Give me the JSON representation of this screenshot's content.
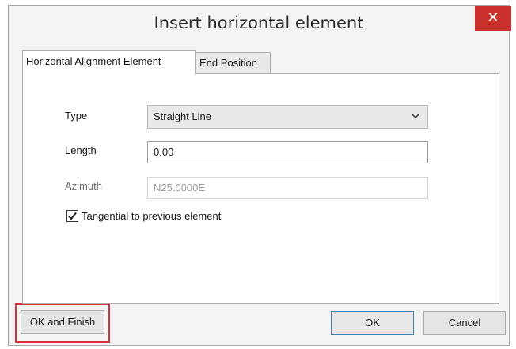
{
  "dialog": {
    "title": "Insert horizontal element",
    "close_glyph": "✕"
  },
  "tabs": [
    {
      "label": "Horizontal Alignment Element",
      "active": true
    },
    {
      "label": "End Position",
      "active": false
    }
  ],
  "form": {
    "type_label": "Type",
    "type_value": "Straight Line",
    "length_label": "Length",
    "length_value": "0.00",
    "azimuth_label": "Azimuth",
    "azimuth_value": "N25.0000E",
    "tangential_label": "Tangential to previous element",
    "tangential_checked": true
  },
  "buttons": {
    "ok_finish": "OK and Finish",
    "ok": "OK",
    "cancel": "Cancel"
  },
  "colors": {
    "close_button": "#c9302c",
    "highlight_box": "#d4313a",
    "default_button_border": "#3c7fb1"
  },
  "icons": {
    "close": "close-icon",
    "dropdown": "chevron-down-icon",
    "check": "checkmark-icon"
  }
}
